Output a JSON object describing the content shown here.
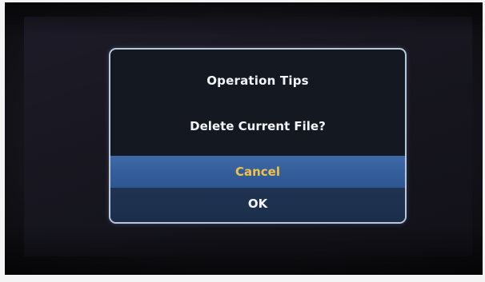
{
  "dialog": {
    "title": "Operation Tips",
    "message": "Delete Current File?",
    "buttons": {
      "cancel_label": "Cancel",
      "ok_label": "OK"
    },
    "selected_button": "Cancel"
  },
  "colors": {
    "dialog_border": "#b9c7d9",
    "selected_button_bg": "#3a63a1",
    "selected_button_text": "#f2c14a",
    "button_text": "#f2f4f8"
  }
}
